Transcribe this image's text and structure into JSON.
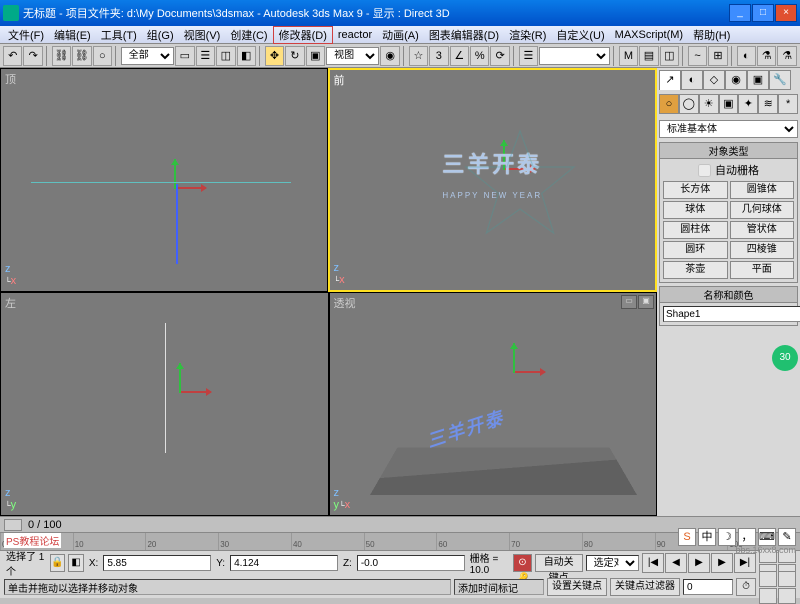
{
  "title": "无标题     - 项目文件夹: d:\\My Documents\\3dsmax     - Autodesk 3ds Max 9     - 显示 : Direct 3D",
  "menu": {
    "file": "文件(F)",
    "edit": "编辑(E)",
    "tools": "工具(T)",
    "group": "组(G)",
    "views": "视图(V)",
    "create": "创建(C)",
    "modifiers": "修改器(D)",
    "reactor": "reactor",
    "animation": "动画(A)",
    "graph": "图表编辑器(D)",
    "render": "渲染(R)",
    "custom": "自定义(U)",
    "maxscript": "MAXScript(M)",
    "help": "帮助(H)"
  },
  "toolbar": {
    "all_combo": "全部"
  },
  "viewports": {
    "top": "顶",
    "front": "前",
    "left": "左",
    "perspective": "透视",
    "view_btn": "视图",
    "text_main": "三羊开泰",
    "text_sub": "HAPPY NEW YEAR"
  },
  "panel": {
    "primitives_combo": "标准基本体",
    "rollout1": "对象类型",
    "autogrid": "自动栅格",
    "obj": {
      "box": "长方体",
      "cone": "圆锥体",
      "sphere": "球体",
      "geosphere": "几何球体",
      "cylinder": "圆柱体",
      "tube": "管状体",
      "torus": "圆环",
      "pyramid": "四棱锥",
      "teapot": "茶壶",
      "plane": "平面"
    },
    "rollout2": "名称和颜色",
    "name_value": "Shape1"
  },
  "timeline": {
    "range": "0  /  100"
  },
  "status": {
    "selection": "选择了 1 个",
    "x": "5.85",
    "y": "4.124",
    "z": "-0.0",
    "grid": "栅格 = 10.0",
    "autokey": "自动关键点",
    "selected_obj": "选定对象",
    "setkey": "设置关键点",
    "keyfilter": "关键点过滤器",
    "help_text": "单击并拖动以选择并移动对象",
    "add_tag": "添加时间标记"
  },
  "ps_label": "PS教程论坛",
  "watermark": "bbs.16xx8.com",
  "badge": "30"
}
